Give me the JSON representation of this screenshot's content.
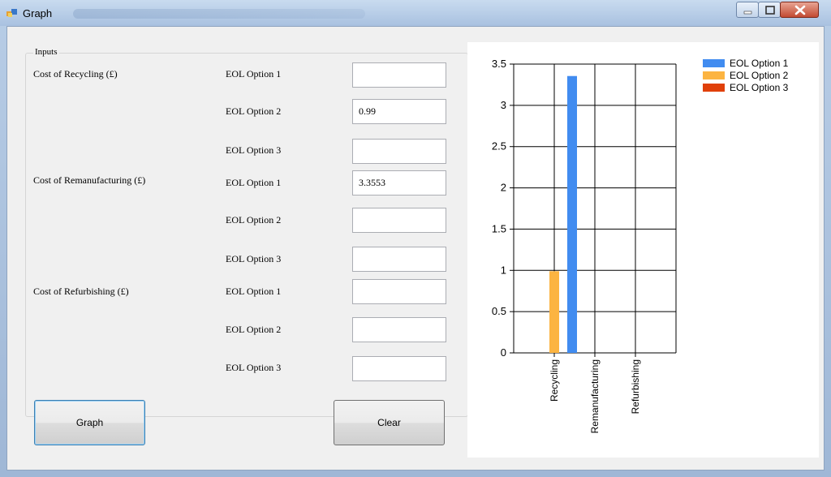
{
  "window": {
    "title": "Graph"
  },
  "inputs": {
    "group_label": "Inputs",
    "recycling_label": "Cost of Recycling (£)",
    "remanufacturing_label": "Cost of Remanufacturing (£)",
    "refurbishing_label": "Cost of Refurbishing (£)",
    "option1_label": "EOL Option 1",
    "option2_label": "EOL Option 2",
    "option3_label": "EOL Option 3",
    "recycling_opt1": "",
    "recycling_opt2": "0.99",
    "recycling_opt3": "",
    "remanufacturing_opt1": "3.3553",
    "remanufacturing_opt2": "",
    "remanufacturing_opt3": "",
    "refurbishing_opt1": "",
    "refurbishing_opt2": "",
    "refurbishing_opt3": ""
  },
  "buttons": {
    "graph_label": "Graph",
    "clear_label": "Clear"
  },
  "chart_data": {
    "type": "bar",
    "categories": [
      "Recycling",
      "Remanufacturing",
      "Refurbishing"
    ],
    "series": [
      {
        "name": "EOL Option 1",
        "color": "#418CF0",
        "values": [
          0,
          3.3553,
          0
        ]
      },
      {
        "name": "EOL Option 2",
        "color": "#FCB441",
        "values": [
          0.99,
          0,
          0
        ]
      },
      {
        "name": "EOL Option 3",
        "color": "#E0400A",
        "values": [
          0,
          0,
          0
        ]
      }
    ],
    "ylim": [
      0,
      3.5
    ],
    "yticks": [
      "0",
      "0.5",
      "1",
      "1.5",
      "2",
      "2.5",
      "3",
      "3.5"
    ],
    "grid": true,
    "legend_position": "top-right"
  }
}
